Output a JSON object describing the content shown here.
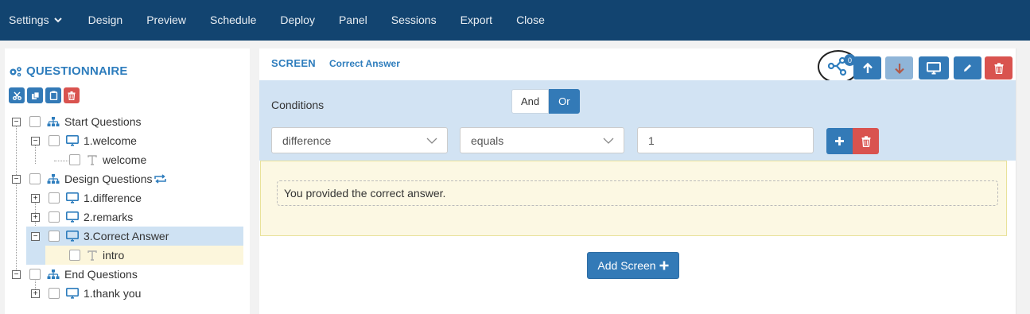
{
  "nav": {
    "settings": "Settings",
    "items": [
      "Design",
      "Preview",
      "Schedule",
      "Deploy",
      "Panel",
      "Sessions",
      "Export",
      "Close"
    ]
  },
  "questionnaire": {
    "title": "QUESTIONNAIRE",
    "tools": [
      "cut-icon",
      "copy-icon",
      "paste-icon",
      "trash-icon"
    ]
  },
  "tree": {
    "start_questions": "Start Questions",
    "welcome_screen": "1.welcome",
    "welcome_item": "welcome",
    "design_questions": "Design Questions",
    "difference_screen": "1.difference",
    "remarks_screen": "2.remarks",
    "correct_answer_screen": "3.Correct Answer",
    "intro_item": "intro",
    "end_questions": "End Questions",
    "thank_you_screen": "1.thank you"
  },
  "screen": {
    "label": "SCREEN",
    "name": "Correct Answer",
    "branch_count": "0"
  },
  "conditions": {
    "label": "Conditions",
    "and": "And",
    "or": "Or",
    "field": "difference",
    "operator": "equals",
    "value": "1"
  },
  "content": {
    "text": "You provided the correct answer."
  },
  "actions": {
    "add_screen": "Add Screen"
  },
  "colors": {
    "nav_bg": "#124470",
    "primary": "#337ab7",
    "danger": "#d9534f",
    "conditions_bg": "#d2e3f3",
    "content_bg": "#fcf8e3"
  }
}
